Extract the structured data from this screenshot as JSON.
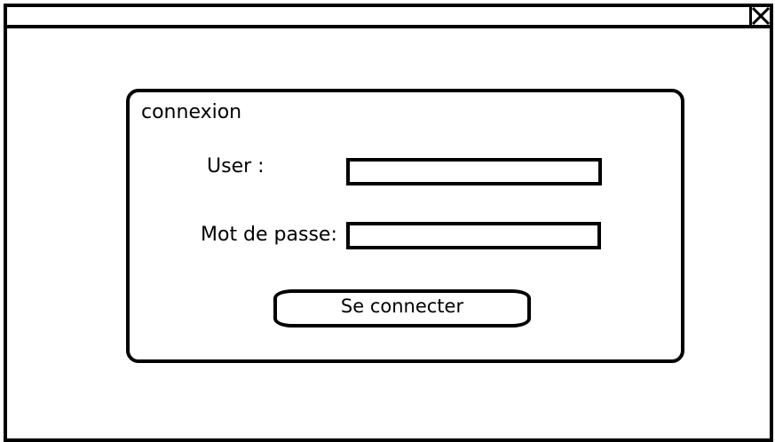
{
  "window": {
    "close_icon": "close-box-icon"
  },
  "login_panel": {
    "title": "connexion",
    "user_label": "User :",
    "user_value": "",
    "password_label": "Mot de passe:",
    "password_value": "",
    "submit_label": "Se connecter"
  },
  "colors": {
    "border": "#000000",
    "background": "#ffffff"
  }
}
